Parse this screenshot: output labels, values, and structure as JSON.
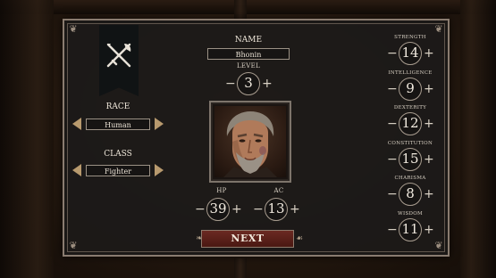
{
  "character": {
    "name_label": "NAME",
    "name_value": "Bhonin",
    "level_label": "LEVEL",
    "level_value": "3",
    "race_label": "RACE",
    "race_value": "Human",
    "class_label": "CLASS",
    "class_value": "Fighter",
    "hp_label": "HP",
    "hp_value": "39",
    "ac_label": "AC",
    "ac_value": "13"
  },
  "stats": [
    {
      "label": "STRENGTH",
      "value": "14"
    },
    {
      "label": "INTELLIGENCE",
      "value": "9"
    },
    {
      "label": "DEXTERITY",
      "value": "12"
    },
    {
      "label": "CONSTITUTION",
      "value": "15"
    },
    {
      "label": "CHARISMA",
      "value": "8"
    },
    {
      "label": "WISDOM",
      "value": "11"
    }
  ],
  "controls": {
    "minus": "−",
    "plus": "+",
    "next_label": "NEXT"
  },
  "colors": {
    "accent_arrow": "#b89a6e",
    "next_button": "#5a1f18",
    "panel_bg": "#1c1a19"
  },
  "icons": [
    "crossed-sword-and-axe-icon",
    "character-portrait"
  ]
}
